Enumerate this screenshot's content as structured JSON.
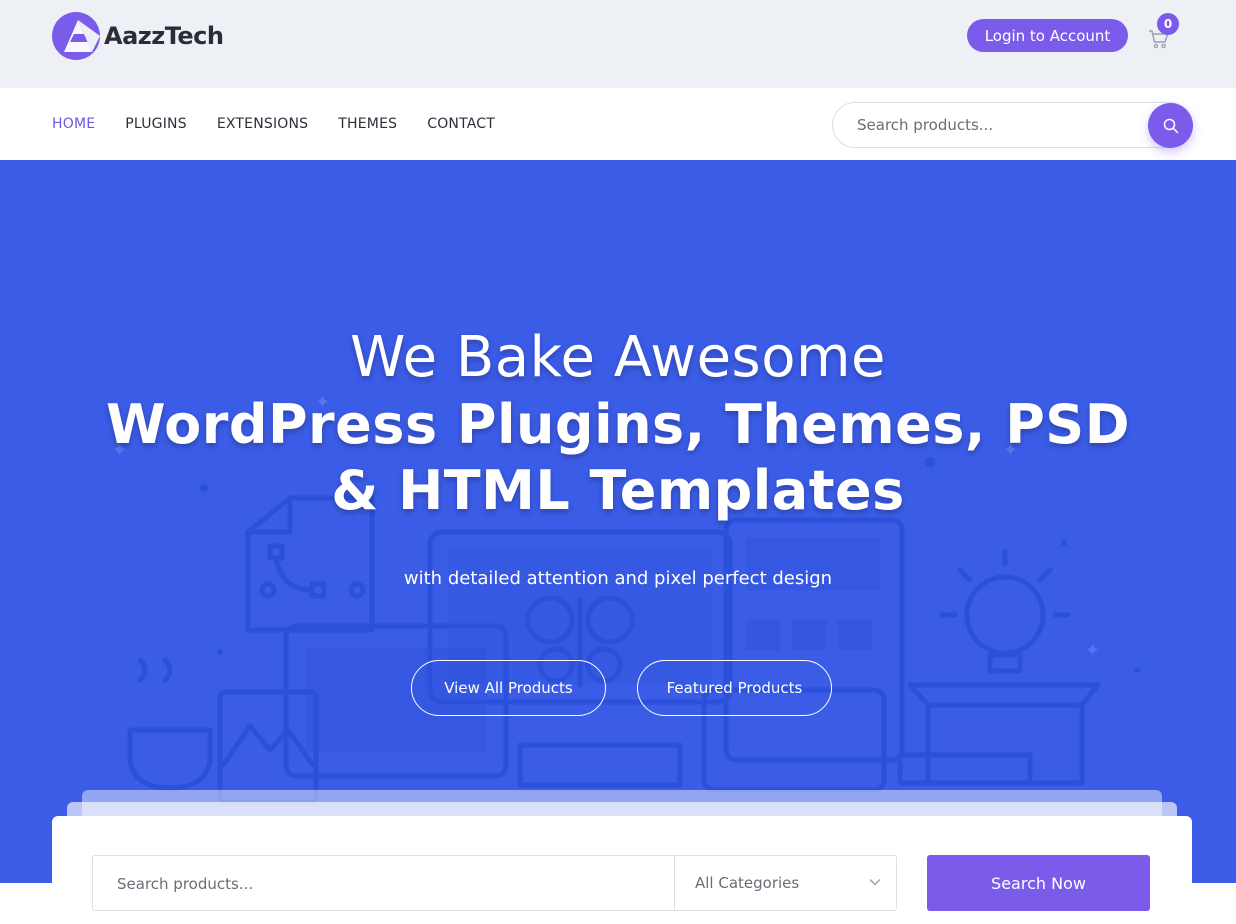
{
  "header": {
    "brand": "AazzTech",
    "login_label": "Login to Account",
    "cart_count": "0"
  },
  "nav": {
    "items": [
      {
        "label": "HOME",
        "active": true
      },
      {
        "label": "PLUGINS",
        "active": false
      },
      {
        "label": "EXTENSIONS",
        "active": false
      },
      {
        "label": "THEMES",
        "active": false
      },
      {
        "label": "CONTACT",
        "active": false
      }
    ],
    "search_placeholder": "Search products..."
  },
  "hero": {
    "line1": "We Bake Awesome",
    "line2": "WordPress Plugins, Themes, PSD & HTML Templates",
    "subtitle": "with detailed attention and pixel perfect design",
    "btn_all": "View All Products",
    "btn_featured": "Featured Products"
  },
  "search_card": {
    "placeholder": "Search products...",
    "category_selected": "All Categories",
    "button_label": "Search Now"
  },
  "colors": {
    "accent": "#7a5bea",
    "hero_bg": "#3b5ce6",
    "topbar_bg": "#edf0f4",
    "nav_active": "#6a58e0"
  },
  "icons": {
    "logo": "logo-mark-icon",
    "cart": "cart-icon",
    "search": "search-icon",
    "chevron": "chevron-down-icon"
  }
}
